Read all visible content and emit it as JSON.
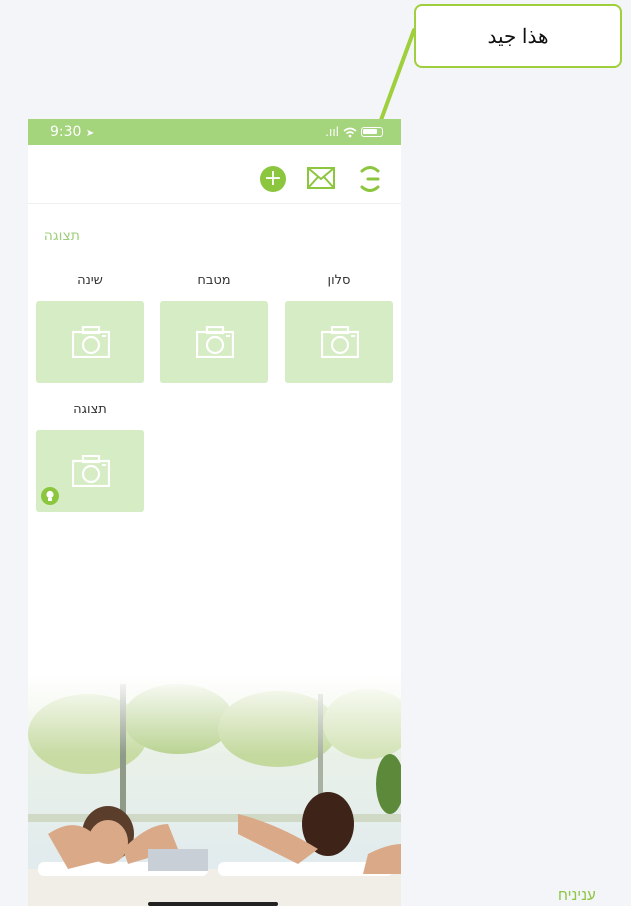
{
  "callout": {
    "text": "هذا جيد"
  },
  "status_bar": {
    "time": "9:30",
    "location_glyph": "➤",
    "signal_glyph": ".ııl"
  },
  "toolbar": {
    "add_icon": "plus-circle-icon",
    "mail_icon": "envelope-icon",
    "refresh_icon": "refresh-icon"
  },
  "section": {
    "title": "תצוגה"
  },
  "rooms": [
    {
      "label": "סלון"
    },
    {
      "label": "מטבח"
    },
    {
      "label": "שינה"
    },
    {
      "label": "תצוגה"
    }
  ],
  "footer": {
    "text": "עניניח"
  },
  "colors": {
    "accent": "#8cc63f",
    "status_bar": "#a4d47c",
    "card": "#d6ecc4",
    "callout_border": "#9fcf3c"
  }
}
